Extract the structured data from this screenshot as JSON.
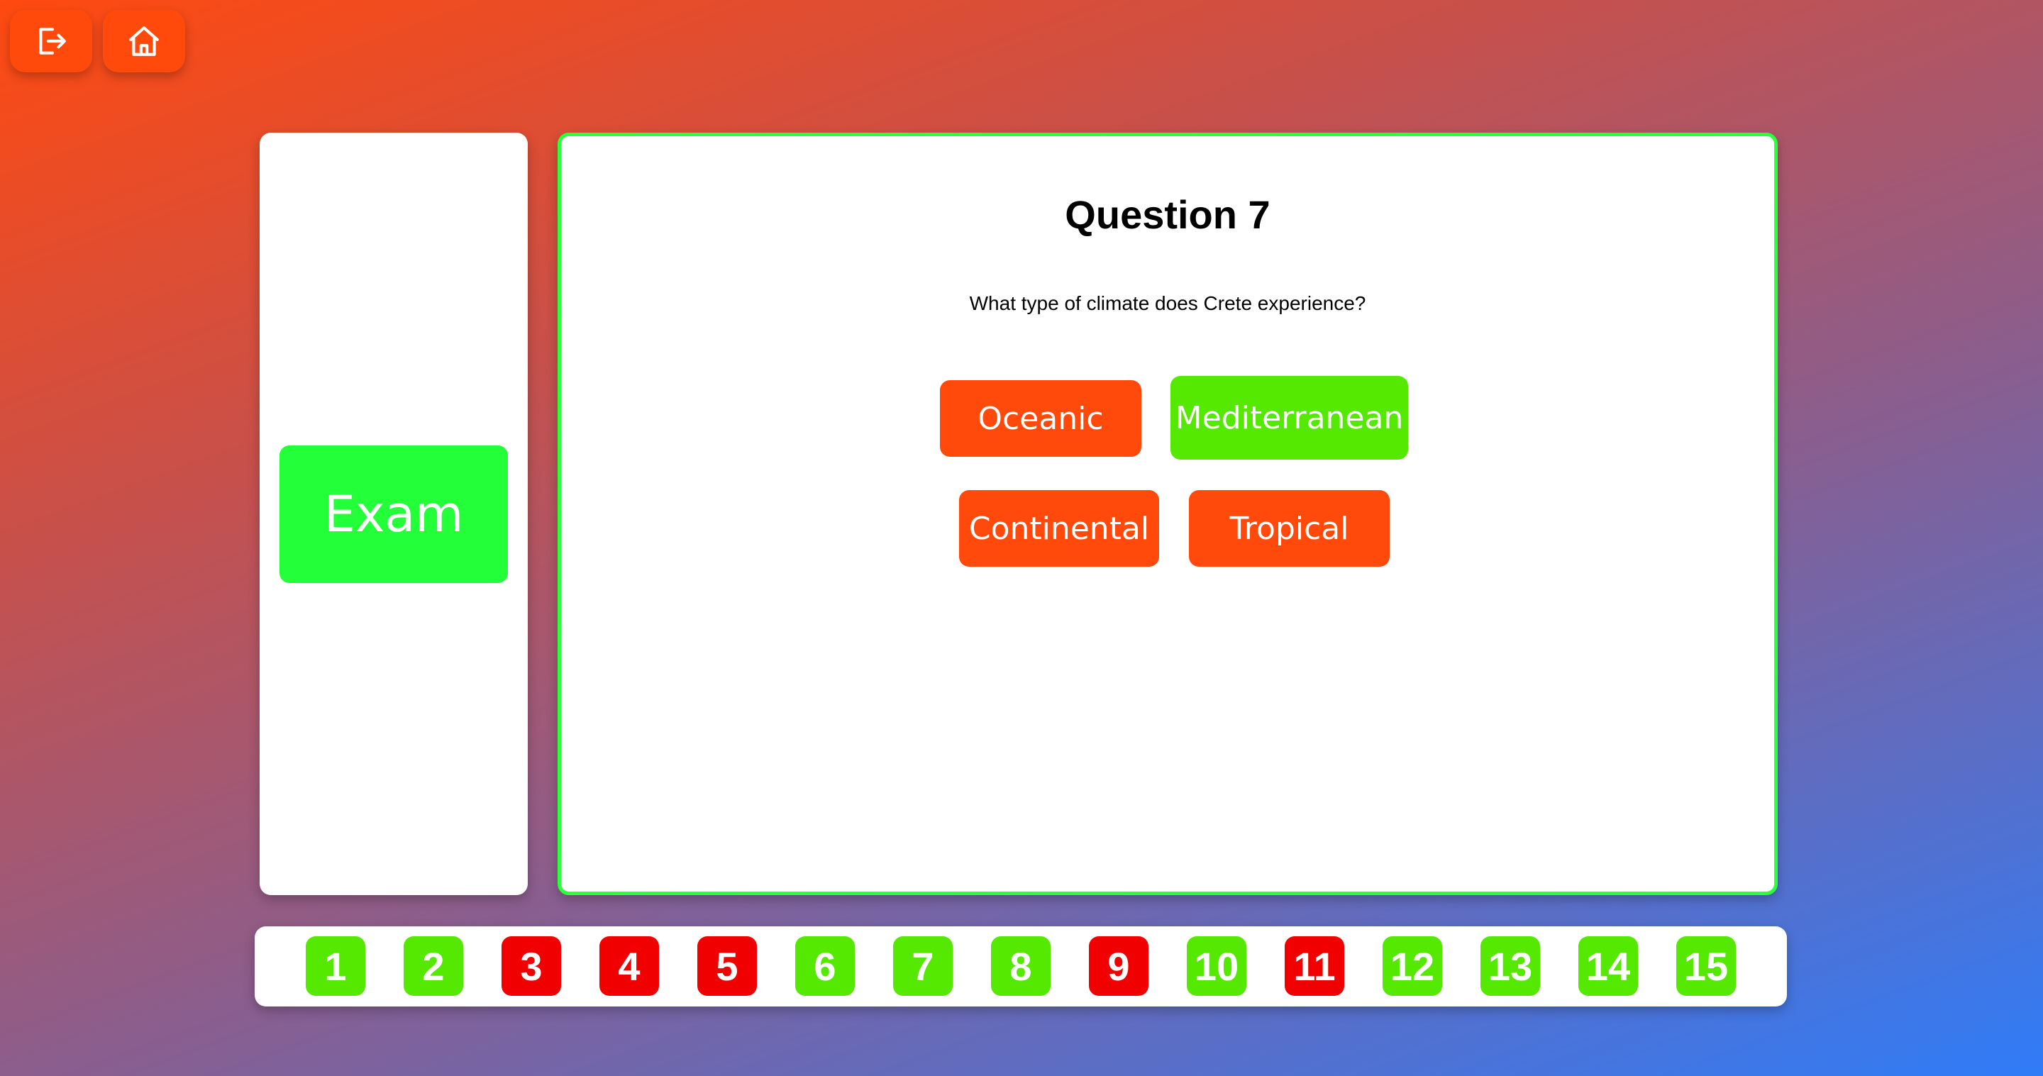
{
  "colors": {
    "accent": "#ff4a0c",
    "correct": "#55e800",
    "wrong": "#f00000",
    "exam": "#23ff39",
    "panel_border": "#2cff3b"
  },
  "toolbar": {
    "exit_icon": "logout-icon",
    "home_icon": "home-icon"
  },
  "sidebar": {
    "exam_label": "Exam"
  },
  "question": {
    "title": "Question 7",
    "text": "What type of climate does Crete experience?",
    "answers": [
      {
        "label": "Oceanic",
        "state": "wrong"
      },
      {
        "label": "Mediterranean",
        "state": "correct"
      },
      {
        "label": "Continental",
        "state": "wrong"
      },
      {
        "label": "Tropical",
        "state": "wrong"
      }
    ]
  },
  "question_nav": [
    {
      "label": "1",
      "status": "correct"
    },
    {
      "label": "2",
      "status": "correct"
    },
    {
      "label": "3",
      "status": "wrong"
    },
    {
      "label": "4",
      "status": "wrong"
    },
    {
      "label": "5",
      "status": "wrong"
    },
    {
      "label": "6",
      "status": "correct"
    },
    {
      "label": "7",
      "status": "correct"
    },
    {
      "label": "8",
      "status": "correct"
    },
    {
      "label": "9",
      "status": "wrong"
    },
    {
      "label": "10",
      "status": "correct"
    },
    {
      "label": "11",
      "status": "wrong"
    },
    {
      "label": "12",
      "status": "correct"
    },
    {
      "label": "13",
      "status": "correct"
    },
    {
      "label": "14",
      "status": "correct"
    },
    {
      "label": "15",
      "status": "correct"
    }
  ]
}
